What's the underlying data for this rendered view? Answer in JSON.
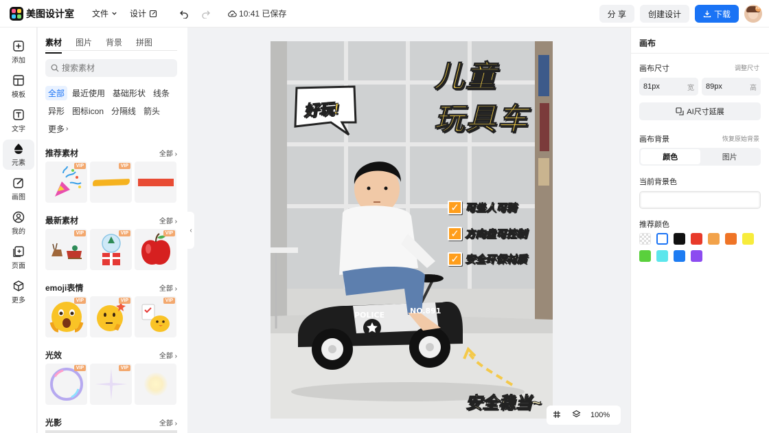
{
  "app": {
    "name": "美图设计室"
  },
  "menu": {
    "file": "文件",
    "design": "设计",
    "saved": "10:41 已保存"
  },
  "actions": {
    "share": "分 享",
    "create": "创建设计",
    "download": "下载"
  },
  "rail": [
    {
      "label": "添加",
      "icon": "plus-square-icon"
    },
    {
      "label": "模板",
      "icon": "template-icon"
    },
    {
      "label": "文字",
      "icon": "text-icon"
    },
    {
      "label": "元素",
      "icon": "shapes-icon",
      "active": true
    },
    {
      "label": "画图",
      "icon": "draw-icon"
    },
    {
      "label": "我的",
      "icon": "user-icon"
    },
    {
      "label": "页面",
      "icon": "add-page-icon"
    },
    {
      "label": "更多",
      "icon": "cube-icon"
    }
  ],
  "panel": {
    "tabs": [
      "素材",
      "图片",
      "背景",
      "拼图"
    ],
    "search_placeholder": "搜索素材",
    "chips": [
      "全部",
      "最近使用",
      "基础形状",
      "线条",
      "异形",
      "图标icon",
      "分隔线",
      "箭头",
      "更多"
    ],
    "all_label": "全部",
    "vip_label": "VIP",
    "sections": [
      {
        "title": "推荐素材",
        "thumbs": [
          "party-popper-icon",
          "yellow-brush-stroke-icon",
          "red-bar-icon"
        ]
      },
      {
        "title": "最新素材",
        "thumbs": [
          "reindeer-sleigh-icon",
          "snow-globe-gift-icon",
          "red-apple-icon"
        ]
      },
      {
        "title": "emoji表情",
        "thumbs": [
          "shocked-emoji-icon",
          "thinking-emoji-icon",
          "chick-checklist-icon"
        ]
      },
      {
        "title": "光效",
        "thumbs": [
          "bubble-ring-icon",
          "sparkle-star-icon",
          "glow-icon"
        ]
      },
      {
        "title": "光影",
        "thumbs": []
      }
    ]
  },
  "canvas": {
    "title_line1": "儿童",
    "title_line2": "玩具车",
    "bubble": "好玩!",
    "checks": [
      "可坐人可骑",
      "方向盘可控制",
      "安全环保材质"
    ],
    "bottom_text": "安全稳当~",
    "car_police": "POLICE",
    "car_no": "NO.891"
  },
  "right_panel": {
    "title": "画布",
    "size_label": "画布尺寸",
    "size_adjust": "调整尺寸",
    "width_value": "81px",
    "width_unit": "宽",
    "height_value": "89px",
    "height_unit": "高",
    "ai_button": "AI尺寸延展",
    "bg_label": "画布背景",
    "bg_reset": "恢复原始背景",
    "seg_color": "颜色",
    "seg_image": "图片",
    "current_bg": "当前背景色",
    "recommended": "推荐颜色",
    "swatches": [
      "transparent",
      "#ffffff",
      "#111111",
      "#e83a2a",
      "#f2a24a",
      "#ef7426",
      "#f7ec3c",
      "#5ad03c",
      "#5ce6ec",
      "#1e7cf2",
      "#8c4cf0"
    ]
  },
  "zoom": {
    "value": "100%"
  }
}
